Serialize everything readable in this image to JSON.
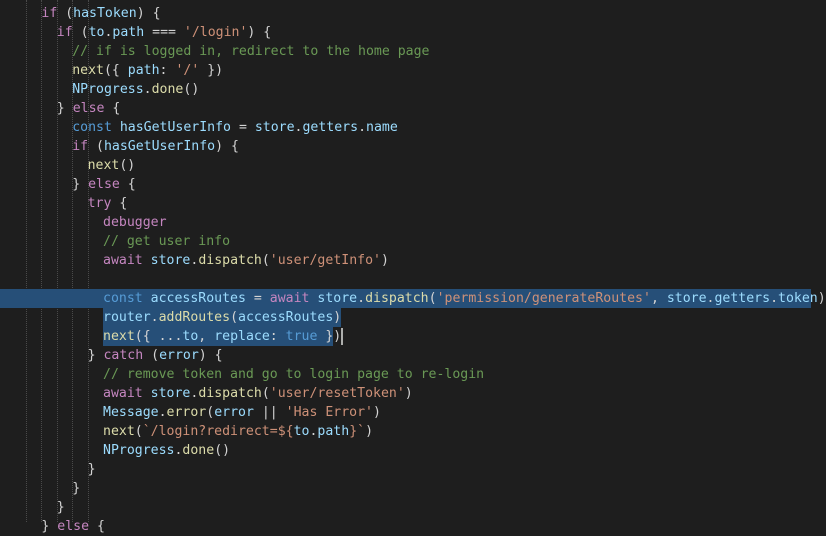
{
  "colors": {
    "background": "#1e1e1e",
    "selection": "#264f78",
    "keyword": "#c586c0",
    "declaration": "#569cd6",
    "variable": "#9cdcfe",
    "function": "#dcdcaa",
    "string": "#ce9178",
    "comment": "#6a9955",
    "plain": "#d4d4d4"
  },
  "editor": {
    "lines": [
      {
        "indent": 2,
        "tokens": [
          [
            "kw",
            "if"
          ],
          [
            "pl",
            " ("
          ],
          [
            "vr",
            "hasToken"
          ],
          [
            "pl",
            ") {"
          ]
        ]
      },
      {
        "indent": 4,
        "tokens": [
          [
            "kw",
            "if"
          ],
          [
            "pl",
            " ("
          ],
          [
            "vr",
            "to"
          ],
          [
            "pl",
            "."
          ],
          [
            "vr",
            "path"
          ],
          [
            "pl",
            " === "
          ],
          [
            "st",
            "'/login'"
          ],
          [
            "pl",
            ") {"
          ]
        ]
      },
      {
        "indent": 6,
        "tokens": [
          [
            "cm",
            "// if is logged in, redirect to the home page"
          ]
        ]
      },
      {
        "indent": 6,
        "tokens": [
          [
            "fn",
            "next"
          ],
          [
            "pl",
            "({ "
          ],
          [
            "vr",
            "path"
          ],
          [
            "pl",
            ": "
          ],
          [
            "st",
            "'/'"
          ],
          [
            "pl",
            " })"
          ]
        ]
      },
      {
        "indent": 6,
        "tokens": [
          [
            "vr",
            "NProgress"
          ],
          [
            "pl",
            "."
          ],
          [
            "fn",
            "done"
          ],
          [
            "pl",
            "()"
          ]
        ]
      },
      {
        "indent": 4,
        "tokens": [
          [
            "pl",
            "} "
          ],
          [
            "kw",
            "else"
          ],
          [
            "pl",
            " {"
          ]
        ]
      },
      {
        "indent": 6,
        "tokens": [
          [
            "dk",
            "const"
          ],
          [
            "pl",
            " "
          ],
          [
            "vr",
            "hasGetUserInfo"
          ],
          [
            "pl",
            " = "
          ],
          [
            "vr",
            "store"
          ],
          [
            "pl",
            "."
          ],
          [
            "vr",
            "getters"
          ],
          [
            "pl",
            "."
          ],
          [
            "vr",
            "name"
          ]
        ]
      },
      {
        "indent": 6,
        "tokens": [
          [
            "kw",
            "if"
          ],
          [
            "pl",
            " ("
          ],
          [
            "vr",
            "hasGetUserInfo"
          ],
          [
            "pl",
            ") {"
          ]
        ]
      },
      {
        "indent": 8,
        "tokens": [
          [
            "fn",
            "next"
          ],
          [
            "pl",
            "()"
          ]
        ]
      },
      {
        "indent": 6,
        "tokens": [
          [
            "pl",
            "} "
          ],
          [
            "kw",
            "else"
          ],
          [
            "pl",
            " {"
          ]
        ]
      },
      {
        "indent": 8,
        "tokens": [
          [
            "kw",
            "try"
          ],
          [
            "pl",
            " {"
          ]
        ]
      },
      {
        "indent": 10,
        "tokens": [
          [
            "kw",
            "debugger"
          ]
        ]
      },
      {
        "indent": 10,
        "tokens": [
          [
            "cm",
            "// get user info"
          ]
        ]
      },
      {
        "indent": 10,
        "tokens": [
          [
            "kw",
            "await"
          ],
          [
            "pl",
            " "
          ],
          [
            "vr",
            "store"
          ],
          [
            "pl",
            "."
          ],
          [
            "fn",
            "dispatch"
          ],
          [
            "pl",
            "("
          ],
          [
            "st",
            "'user/getInfo'"
          ],
          [
            "pl",
            ")"
          ]
        ]
      },
      {
        "indent": 0,
        "tokens": []
      },
      {
        "indent": 10,
        "tokens": [
          [
            "dk",
            "const"
          ],
          [
            "pl",
            " "
          ],
          [
            "vr",
            "accessRoutes"
          ],
          [
            "pl",
            " = "
          ],
          [
            "kw",
            "await"
          ],
          [
            "pl",
            " "
          ],
          [
            "vr",
            "store"
          ],
          [
            "pl",
            "."
          ],
          [
            "fn",
            "dispatch"
          ],
          [
            "pl",
            "("
          ],
          [
            "st",
            "'permission/generateRoutes'"
          ],
          [
            "pl",
            ", "
          ],
          [
            "vr",
            "store"
          ],
          [
            "pl",
            "."
          ],
          [
            "vr",
            "getters"
          ],
          [
            "pl",
            "."
          ],
          [
            "vr",
            "token"
          ],
          [
            "pl",
            ")"
          ]
        ]
      },
      {
        "indent": 10,
        "tokens": [
          [
            "vr",
            "router"
          ],
          [
            "pl",
            "."
          ],
          [
            "fn",
            "addRoutes"
          ],
          [
            "pl",
            "("
          ],
          [
            "vr",
            "accessRoutes"
          ],
          [
            "pl",
            ")"
          ]
        ]
      },
      {
        "indent": 10,
        "tokens": [
          [
            "fn",
            "next"
          ],
          [
            "pl",
            "({ ..."
          ],
          [
            "vr",
            "to"
          ],
          [
            "pl",
            ", "
          ],
          [
            "vr",
            "replace"
          ],
          [
            "pl",
            ": "
          ],
          [
            "dk",
            "true"
          ],
          [
            "pl",
            " })"
          ]
        ]
      },
      {
        "indent": 8,
        "tokens": [
          [
            "pl",
            "} "
          ],
          [
            "kw",
            "catch"
          ],
          [
            "pl",
            " ("
          ],
          [
            "vr",
            "error"
          ],
          [
            "pl",
            ") {"
          ]
        ]
      },
      {
        "indent": 10,
        "tokens": [
          [
            "cm",
            "// remove token and go to login page to re-login"
          ]
        ]
      },
      {
        "indent": 10,
        "tokens": [
          [
            "kw",
            "await"
          ],
          [
            "pl",
            " "
          ],
          [
            "vr",
            "store"
          ],
          [
            "pl",
            "."
          ],
          [
            "fn",
            "dispatch"
          ],
          [
            "pl",
            "("
          ],
          [
            "st",
            "'user/resetToken'"
          ],
          [
            "pl",
            ")"
          ]
        ]
      },
      {
        "indent": 10,
        "tokens": [
          [
            "vr",
            "Message"
          ],
          [
            "pl",
            "."
          ],
          [
            "fn",
            "error"
          ],
          [
            "pl",
            "("
          ],
          [
            "vr",
            "error"
          ],
          [
            "pl",
            " || "
          ],
          [
            "st",
            "'Has Error'"
          ],
          [
            "pl",
            ")"
          ]
        ]
      },
      {
        "indent": 10,
        "tokens": [
          [
            "fn",
            "next"
          ],
          [
            "pl",
            "("
          ],
          [
            "st",
            "`/login?redirect=${"
          ],
          [
            "vr",
            "to"
          ],
          [
            "pl",
            "."
          ],
          [
            "vr",
            "path"
          ],
          [
            "st",
            "}`"
          ],
          [
            "pl",
            ")"
          ]
        ]
      },
      {
        "indent": 10,
        "tokens": [
          [
            "vr",
            "NProgress"
          ],
          [
            "pl",
            "."
          ],
          [
            "fn",
            "done"
          ],
          [
            "pl",
            "()"
          ]
        ]
      },
      {
        "indent": 8,
        "tokens": [
          [
            "pl",
            "}"
          ]
        ]
      },
      {
        "indent": 6,
        "tokens": [
          [
            "pl",
            "}"
          ]
        ]
      },
      {
        "indent": 4,
        "tokens": [
          [
            "pl",
            "}"
          ]
        ]
      },
      {
        "indent": 2,
        "tokens": [
          [
            "pl",
            "} "
          ],
          [
            "kw",
            "else"
          ],
          [
            "pl",
            " {"
          ]
        ]
      }
    ]
  }
}
